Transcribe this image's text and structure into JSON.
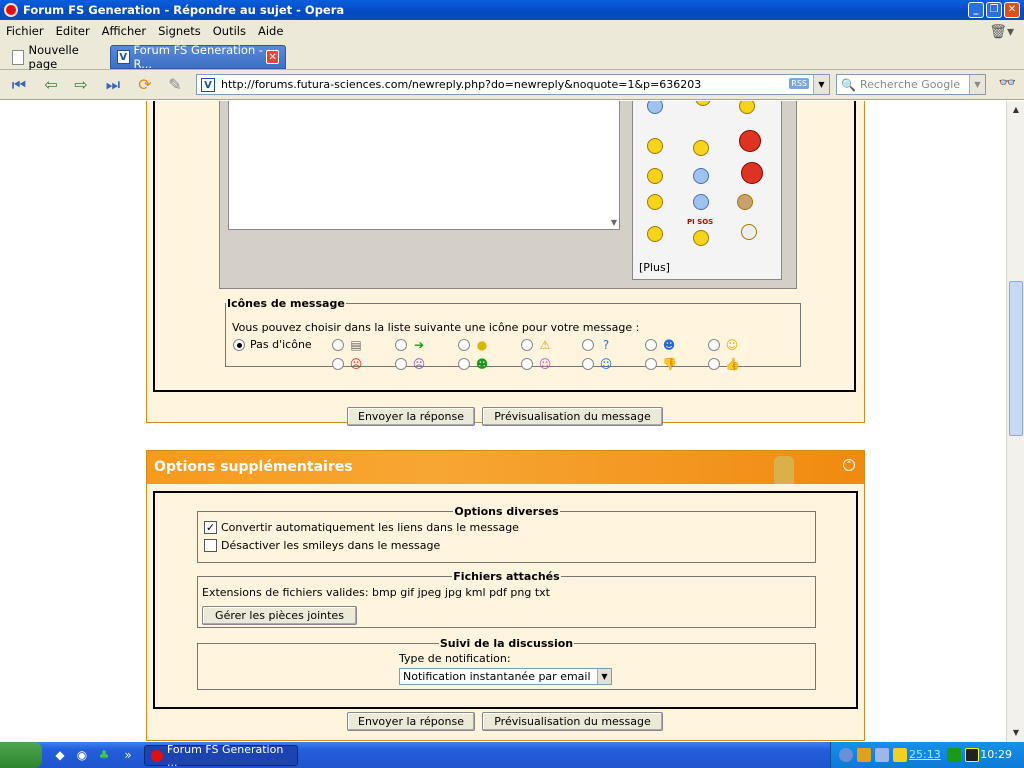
{
  "window": {
    "title": "Forum FS Generation - Répondre au sujet - Opera"
  },
  "menu": [
    "Fichier",
    "Editer",
    "Afficher",
    "Signets",
    "Outils",
    "Aide"
  ],
  "tabs": {
    "new_tab": "Nouvelle page",
    "active": "Forum FS Generation - R..."
  },
  "address": {
    "url": "http://forums.futura-sciences.com/newreply.php?do=newreply&noquote=1&p=636203",
    "rss": "RSS"
  },
  "search": {
    "placeholder": "Recherche Google"
  },
  "editor": {
    "more_smilies": "[Plus]",
    "smiley_sign": "PI SOS"
  },
  "message_icons": {
    "legend": "Icônes de message",
    "description": "Vous pouvez choisir dans la liste suivante une icône pour votre message :",
    "no_icon_label": "Pas d'icône"
  },
  "buttons": {
    "submit": "Envoyer la réponse",
    "preview": "Prévisualisation du message"
  },
  "extra_options": {
    "title": "Options supplémentaires",
    "misc": {
      "legend": "Options diverses",
      "convert_links": "Convertir automatiquement les liens dans le message",
      "disable_smilies": "Désactiver les smileys dans le message"
    },
    "attachments": {
      "legend": "Fichiers attachés",
      "extensions": "Extensions de fichiers valides: bmp gif jpeg jpg kml pdf png txt",
      "manage_button": "Gérer les pièces jointes"
    },
    "subscription": {
      "legend": "Suivi de la discussion",
      "notification_label": "Type de notification:",
      "notification_value": "Notification instantanée par email"
    }
  },
  "taskbar": {
    "task": "Forum FS Generation ...",
    "clock": "10:29",
    "tray_text": "25:13"
  }
}
